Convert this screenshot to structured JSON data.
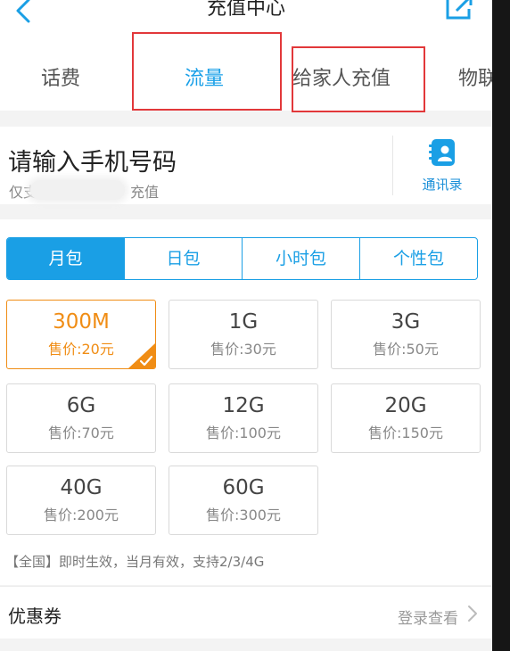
{
  "header": {
    "title": "充值中心"
  },
  "tabs": [
    {
      "label": "话费",
      "active": false
    },
    {
      "label": "流量",
      "active": true
    },
    {
      "label": "给家人充值",
      "active": false
    },
    {
      "label": "物联",
      "active": false
    }
  ],
  "phone": {
    "title": "请输入手机号码",
    "subtitle_start": "仅支",
    "subtitle_end": "充值"
  },
  "contacts": {
    "label": "通讯录",
    "icon": "contacts-icon"
  },
  "segments": [
    {
      "label": "月包",
      "active": true
    },
    {
      "label": "日包",
      "active": false
    },
    {
      "label": "小时包",
      "active": false
    },
    {
      "label": "个性包",
      "active": false
    }
  ],
  "packages": [
    {
      "size": "300M",
      "price": "售价:20元",
      "selected": true
    },
    {
      "size": "1G",
      "price": "售价:30元",
      "selected": false
    },
    {
      "size": "3G",
      "price": "售价:50元",
      "selected": false
    },
    {
      "size": "6G",
      "price": "售价:70元",
      "selected": false
    },
    {
      "size": "12G",
      "price": "售价:100元",
      "selected": false
    },
    {
      "size": "20G",
      "price": "售价:150元",
      "selected": false
    },
    {
      "size": "40G",
      "price": "售价:200元",
      "selected": false
    },
    {
      "size": "60G",
      "price": "售价:300元",
      "selected": false
    }
  ],
  "note": "【全国】即时生效，当月有效，支持2/3/4G",
  "coupon": {
    "label": "优惠券",
    "link": "登录查看"
  },
  "colors": {
    "accent": "#1a9fe5",
    "selected": "#f08d15",
    "highlight_box": "#e2383a"
  }
}
